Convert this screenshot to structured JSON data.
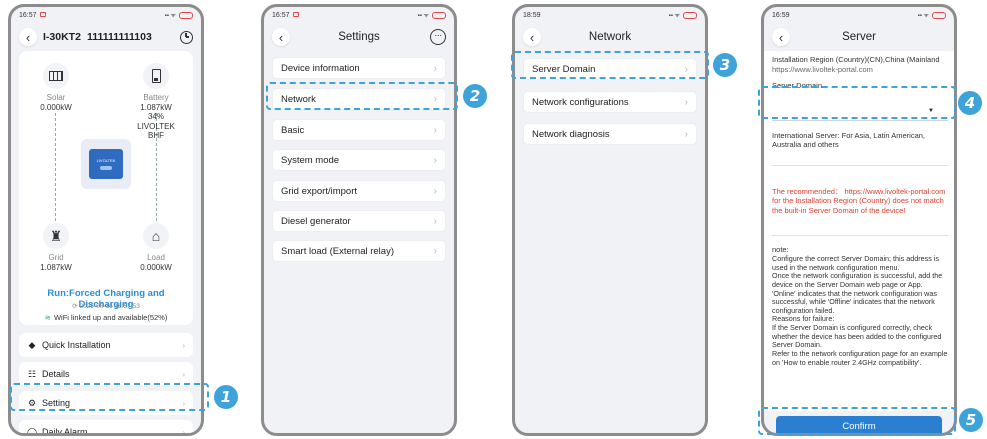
{
  "phone1": {
    "time": "16:57",
    "title": "I-30KT2",
    "serial": "111111111103",
    "solar": {
      "label": "Solar",
      "value": "0.000kW"
    },
    "battery": {
      "label": "Battery",
      "value": "1.087kW",
      "soc": "34%",
      "brand": "LIVOLTEK",
      "type": "BHF"
    },
    "grid": {
      "label": "Grid",
      "value": "1.087kW"
    },
    "load": {
      "label": "Load",
      "value": "0.000kW"
    },
    "inverter_logo": "LIVOLTEK",
    "run_status": "Run:Forced Charging and Discharging",
    "run_time": "2025-06-16 16:57:53",
    "wifi_status": "WiFi linked up and available(52%)",
    "menu": [
      "Quick Installation",
      "Details",
      "Setting",
      "Daily Alarm"
    ]
  },
  "phone2": {
    "time": "16:57",
    "title": "Settings",
    "items": [
      "Device information",
      "Network",
      "Basic",
      "System mode",
      "Grid export/import",
      "Diesel generator",
      "Smart load (External relay)"
    ]
  },
  "phone3": {
    "time": "18:59",
    "title": "Network",
    "items": [
      "Server Domain",
      "Network configurations",
      "Network diagnosis"
    ]
  },
  "phone4": {
    "time": "16:59",
    "title": "Server",
    "region": "Installation Region (Country)(CN),China (Mainland",
    "portal": "https://www.livoltek-portal.com",
    "domain_label": "Server Domain",
    "intl_server": "International Server: For Asia, Latin American, Australia and others",
    "recommended": "The recommended： https://www.livoltek-portal.com for the Installation Region (Country) does not match the built-in Server Domain of the device!",
    "note_title": "note:",
    "note_body": " Configure the correct Server Domain; this address is used in the network configuration menu.\nOnce the network configuration is successful, add the device on the Server Domain web page or App.\n'Online' indicates that the network configuration was successful, while 'Offline' indicates that the network configuration failed.\nReasons for failure:\nIf the Server Domain is configured correctly, check whether the device has been added to the configured Server Domain.\nRefer to the network configuration page for an example on 'How to enable router 2.4GHz compatibility'.",
    "confirm": "Confirm"
  },
  "callouts": [
    "1",
    "2",
    "3",
    "4",
    "5"
  ],
  "colors": {
    "accent": "#3da3d9",
    "primary": "#2b7fd0",
    "status": "#2a8fd6",
    "warning": "#e2402f"
  }
}
